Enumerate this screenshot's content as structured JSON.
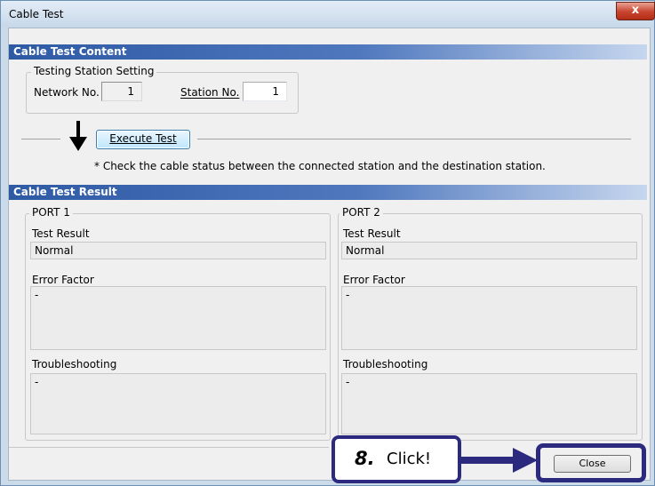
{
  "window": {
    "title": "Cable Test",
    "close_glyph": "x"
  },
  "content_section": {
    "header": "Cable Test Content",
    "testing_group": {
      "label": "Testing Station Setting",
      "network_label": "Network No.",
      "network_value": "1",
      "station_label": "Station No.",
      "station_value": "1"
    },
    "execute_button": "Execute Test",
    "note": "* Check the cable status between the connected station and the destination station."
  },
  "result_section": {
    "header": "Cable Test Result",
    "ports": [
      {
        "label": "PORT 1",
        "test_result_label": "Test Result",
        "test_result": "Normal",
        "error_factor_label": "Error Factor",
        "error_factor": "-",
        "troubleshooting_label": "Troubleshooting",
        "troubleshooting": "-"
      },
      {
        "label": "PORT 2",
        "test_result_label": "Test Result",
        "test_result": "Normal",
        "error_factor_label": "Error Factor",
        "error_factor": "-",
        "troubleshooting_label": "Troubleshooting",
        "troubleshooting": "-"
      }
    ]
  },
  "footer": {
    "close_button": "Close"
  },
  "annotation": {
    "step": "8.",
    "text": "Click!"
  },
  "colors": {
    "section_header": "#2e5aa4",
    "callout_border": "#2b2a7f"
  }
}
